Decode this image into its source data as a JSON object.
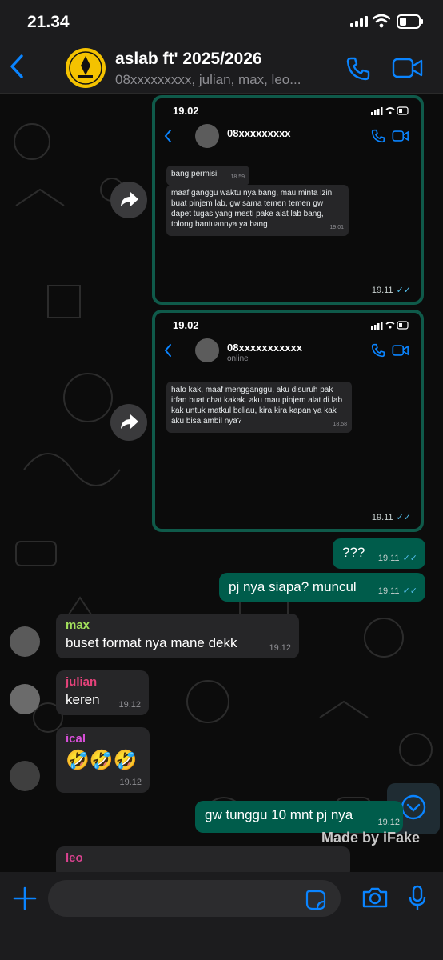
{
  "status_bar": {
    "time": "21.34"
  },
  "header": {
    "title": "aslab ft' 2025/2026",
    "subtitle": "08xxxxxxxxx, julian, max, leo...",
    "logo_text": "UNIVERSITAS INDONESIA"
  },
  "forwarded": [
    {
      "mini_time": "19.02",
      "contact_name": "08xxxxxxxxx",
      "contact_status": "",
      "messages": [
        {
          "text": "bang permisi",
          "time": "18.59"
        },
        {
          "text": "maaf ganggu waktu nya bang, mau minta izin buat pinjem lab, gw sama temen temen gw dapet tugas yang mesti pake alat lab bang, tolong bantuannya ya bang",
          "time": "19.01"
        }
      ],
      "time": "19.11"
    },
    {
      "mini_time": "19.02",
      "contact_name": "08xxxxxxxxxxx",
      "contact_status": "online",
      "messages": [
        {
          "text": "halo kak, maaf mengganggu, aku disuruh pak irfan buat chat kakak. aku mau pinjem alat di lab kak untuk matkul beliau, kira kira kapan ya kak aku bisa ambil nya?",
          "time": "18.58"
        }
      ],
      "time": "19.11"
    }
  ],
  "messages": [
    {
      "text": "???",
      "time": "19.11"
    },
    {
      "text": "pj nya siapa? muncul",
      "time": "19.11"
    },
    {
      "sender": "max",
      "sender_color": "#a3e05c",
      "text": "buset format nya mane dekk",
      "time": "19.12"
    },
    {
      "sender": "julian",
      "sender_color": "#e5437b",
      "text": "keren",
      "time": "19.12"
    },
    {
      "sender": "ical",
      "sender_color": "#d84fd9",
      "text": "🤣🤣🤣",
      "time": "19.12"
    },
    {
      "text": "gw tunggu 10 mnt pj nya",
      "time": "19.12"
    },
    {
      "sender": "leo",
      "sender_color": "#d9428f",
      "text": ""
    }
  ],
  "watermark": "Made by iFake",
  "input": {
    "placeholder": ""
  },
  "colors": {
    "accent": "#0a84ff",
    "outgoing": "#005c4b",
    "incoming": "#262628",
    "read_tick": "#53bdeb"
  }
}
